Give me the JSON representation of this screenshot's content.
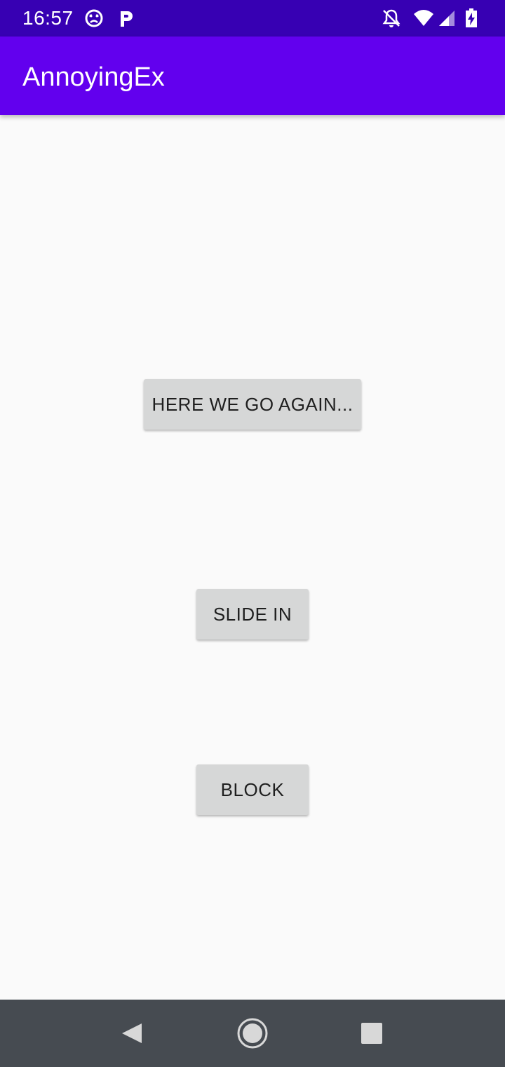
{
  "status_bar": {
    "time": "16:57",
    "icons": [
      "dead-face-icon",
      "parking-p-icon",
      "notifications-off-icon",
      "wifi-icon",
      "cell-signal-icon",
      "battery-charging-icon"
    ],
    "color": "#3700b3"
  },
  "app_bar": {
    "title": "AnnoyingEx",
    "color": "#6200ee"
  },
  "buttons": {
    "here_we_go_again": "HERE WE GO AGAIN...",
    "slide_in": "SLIDE IN",
    "block": "BLOCK"
  },
  "nav_bar": {
    "icons": [
      "back-icon",
      "home-icon",
      "recents-icon"
    ],
    "color": "#464b51"
  }
}
